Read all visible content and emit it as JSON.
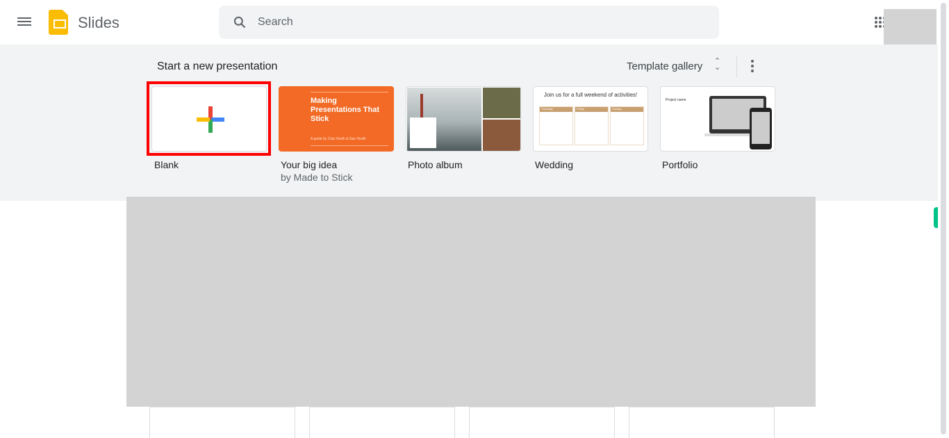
{
  "header": {
    "app_name": "Slides",
    "search_placeholder": "Search"
  },
  "new_presentation": {
    "title": "Start a new presentation",
    "gallery_label": "Template gallery",
    "templates": [
      {
        "label": "Blank",
        "sub": ""
      },
      {
        "label": "Your big idea",
        "sub": "by Made to Stick",
        "thumb_title": "Making Presentations That Stick",
        "thumb_caption": "A guide by Chip Heath & Dan Heath"
      },
      {
        "label": "Photo album",
        "sub": ""
      },
      {
        "label": "Wedding",
        "sub": "",
        "thumb_title": "Join us for a full weekend of activities!",
        "days": [
          "Thursday",
          "Friday",
          "Sunday"
        ]
      },
      {
        "label": "Portfolio",
        "sub": "",
        "thumb_title": "Project name"
      }
    ]
  },
  "colors": {
    "highlight": "#ff0000",
    "orange": "#f26a25",
    "logo": "#fbbc04"
  }
}
